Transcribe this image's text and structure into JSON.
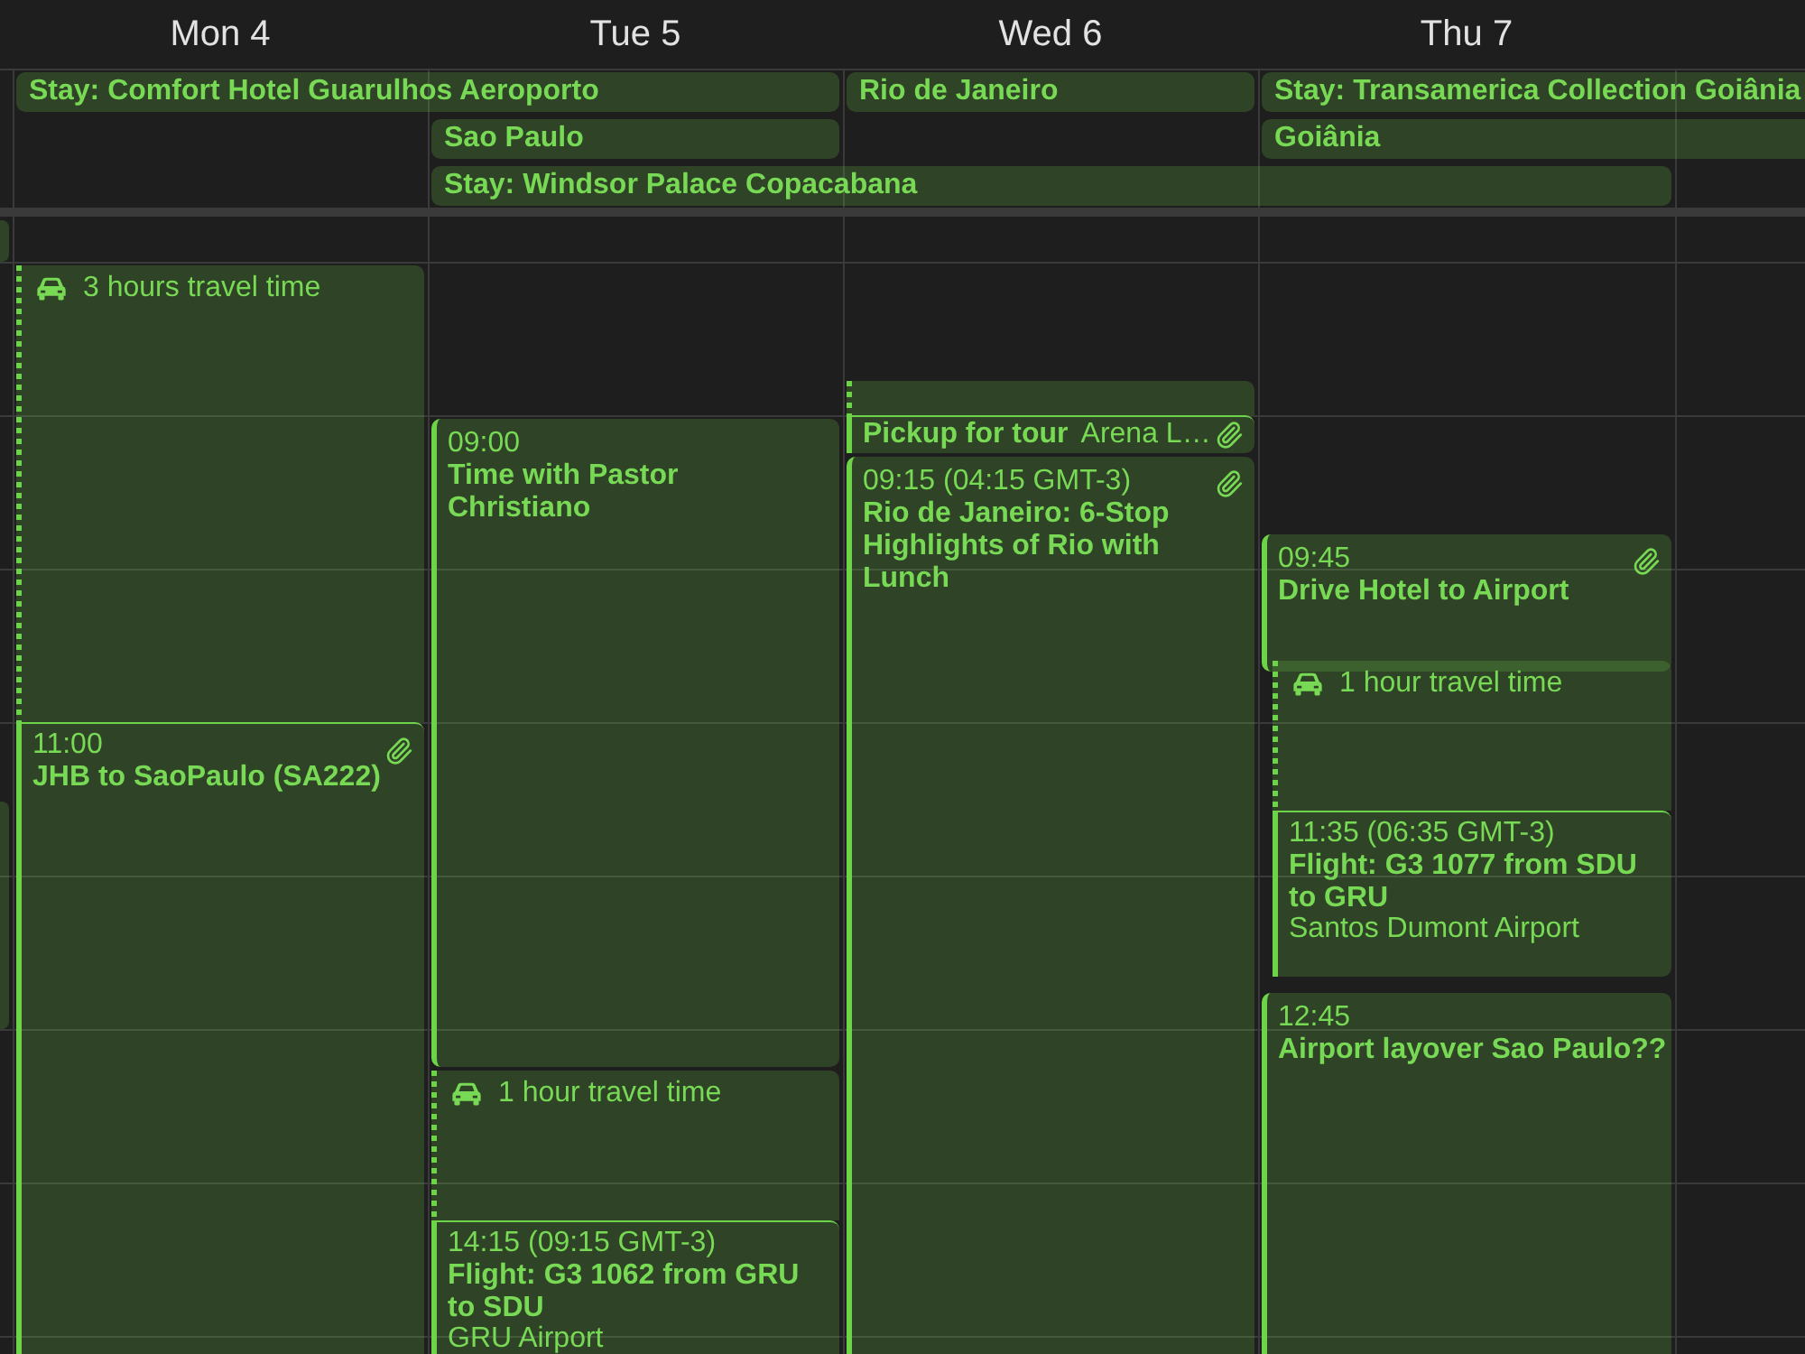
{
  "days": [
    {
      "label": "Mon 4",
      "events": [
        {
          "kind": "travel",
          "text": "3 hours travel time"
        },
        {
          "kind": "event",
          "time": "11:00",
          "title": "JHB to SaoPaulo (SA222)",
          "attachment": true
        }
      ]
    },
    {
      "label": "Tue 5",
      "events": [
        {
          "kind": "event",
          "time": "09:00",
          "title": "Time with Pastor Christiano",
          "attachment": false
        },
        {
          "kind": "travel",
          "text": "1 hour travel time"
        },
        {
          "kind": "event",
          "time": "14:15 (09:15 GMT-3)",
          "title": "Flight: G3 1062 from GRU to SDU",
          "location": "GRU Airport",
          "attachment": false
        }
      ]
    },
    {
      "label": "Wed 6",
      "events": [
        {
          "kind": "travel"
        },
        {
          "kind": "event",
          "title": "Pickup for tour",
          "location": "Arena L…",
          "attachment": true
        },
        {
          "kind": "event",
          "time": "09:15 (04:15 GMT-3)",
          "title": "Rio de Janeiro: 6-Stop Highlights of Rio with Lunch",
          "attachment": true
        }
      ]
    },
    {
      "label": "Thu 7",
      "events": [
        {
          "kind": "event",
          "time": "09:45",
          "title": "Drive Hotel to Airport",
          "attachment": true
        },
        {
          "kind": "travel",
          "text": "1 hour travel time"
        },
        {
          "kind": "event",
          "time": "11:35 (06:35 GMT-3)",
          "title": "Flight: G3 1077 from SDU to GRU",
          "location": "Santos Dumont Airport",
          "attachment": false
        },
        {
          "kind": "event",
          "time": "12:45",
          "title": "Airport layover Sao Paulo??",
          "attachment": false
        }
      ]
    }
  ],
  "all_day_events": [
    {
      "title": "Stay: Comfort Hotel Guarulhos Aeroporto"
    },
    {
      "title": "Rio de Janeiro"
    },
    {
      "title": "Stay: Transamerica Collection Goiânia"
    },
    {
      "title": "Sao Paulo"
    },
    {
      "title": "Goiânia"
    },
    {
      "title": "Stay: Windsor Palace Copacabana"
    }
  ],
  "previous_day_events": [
    {
      "kind": "event"
    },
    {
      "kind": "event"
    }
  ]
}
